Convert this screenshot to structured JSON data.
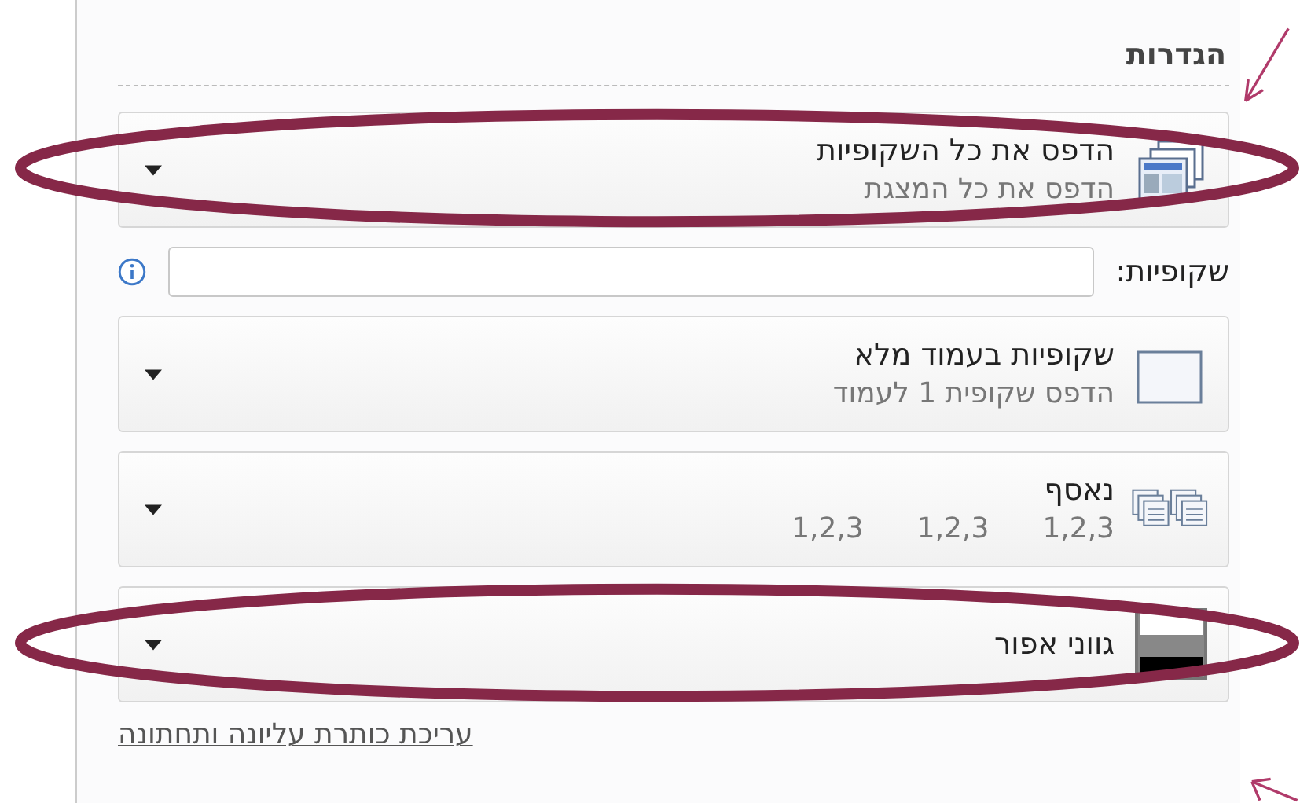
{
  "section_title": "הגדרות",
  "dropdowns": [
    {
      "kind": "slides",
      "title": "הדפס את כל השקופיות",
      "subtitle": "הדפס את כל המצגת",
      "circled": true
    },
    {
      "kind": "full-page",
      "title": "שקופיות בעמוד מלא",
      "subtitle": "הדפס שקופית 1 לעמוד",
      "circled": false
    },
    {
      "kind": "collated",
      "title": "נאסף",
      "sequences": [
        "1,2,3",
        "1,2,3",
        "1,2,3"
      ],
      "circled": false
    },
    {
      "kind": "grayscale",
      "title": "גווני אפור",
      "circled": true
    }
  ],
  "slides_field": {
    "label": "שקופיות:"
  },
  "link": "עריכת כותרת עליונה ותחתונה"
}
